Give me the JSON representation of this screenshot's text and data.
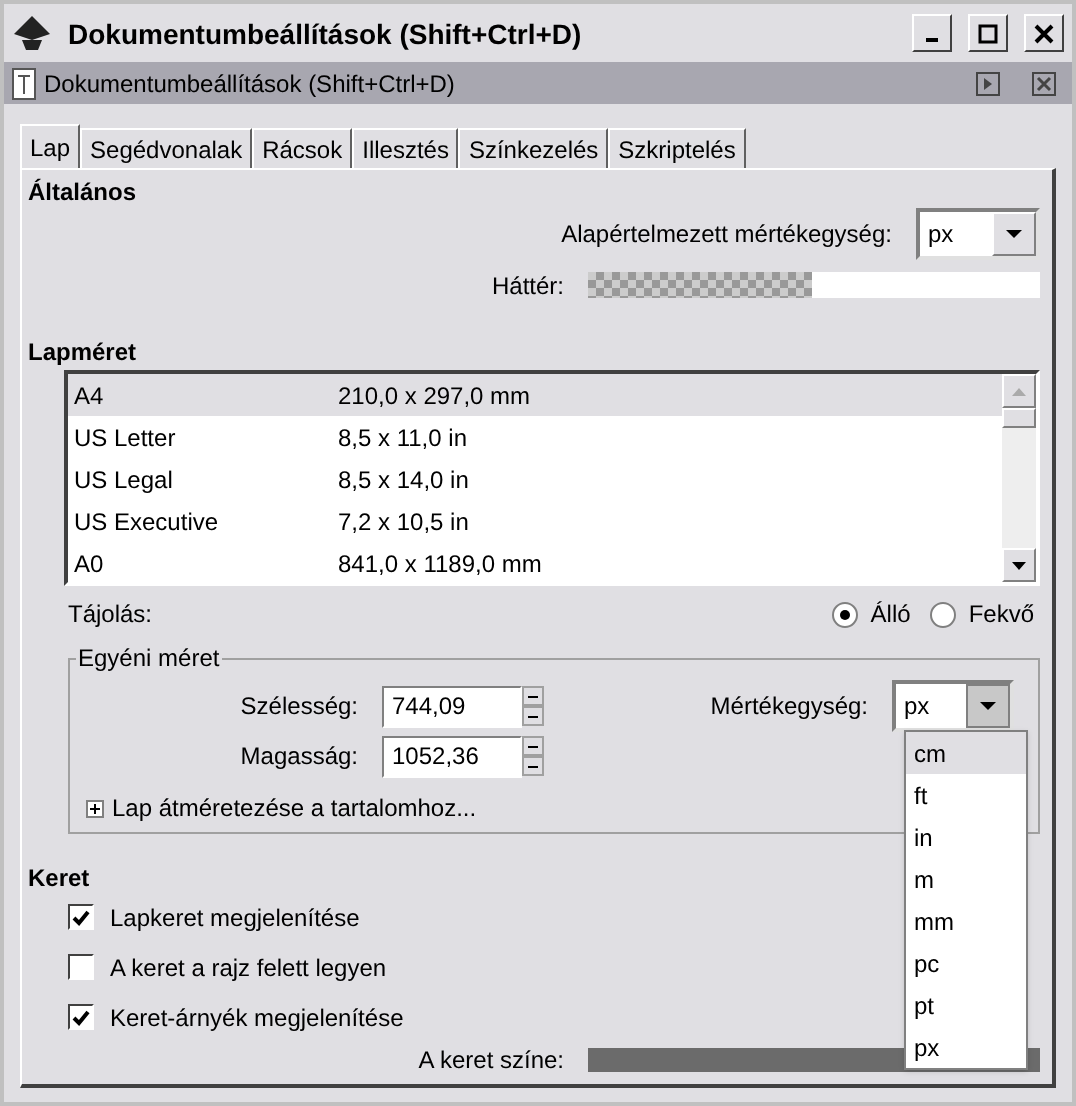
{
  "window": {
    "title": "Dokumentumbeállítások (Shift+Ctrl+D)"
  },
  "dock": {
    "title": "Dokumentumbeállítások (Shift+Ctrl+D)"
  },
  "tabs": [
    {
      "label": "Lap",
      "selected": true
    },
    {
      "label": "Segédvonalak",
      "selected": false
    },
    {
      "label": "Rácsok",
      "selected": false
    },
    {
      "label": "Illesztés",
      "selected": false
    },
    {
      "label": "Színkezelés",
      "selected": false
    },
    {
      "label": "Szkriptelés",
      "selected": false
    }
  ],
  "general": {
    "heading": "Általános",
    "unit_label": "Alapértelmezett mértékegység:",
    "unit_value": "px",
    "background_label": "Háttér:"
  },
  "page_size": {
    "heading": "Lapméret",
    "rows": [
      {
        "name": "A4",
        "size": "210,0 x 297,0 mm",
        "selected": true
      },
      {
        "name": "US Letter",
        "size": "8,5 x 11,0 in",
        "selected": false
      },
      {
        "name": "US Legal",
        "size": "8,5 x 14,0 in",
        "selected": false
      },
      {
        "name": "US Executive",
        "size": "7,2 x 10,5 in",
        "selected": false
      },
      {
        "name": "A0",
        "size": "841,0 x 1189,0 mm",
        "selected": false
      }
    ]
  },
  "orientation": {
    "label": "Tájolás:",
    "options": [
      {
        "label": "Álló",
        "selected": true
      },
      {
        "label": "Fekvő",
        "selected": false
      }
    ]
  },
  "custom_size": {
    "legend": "Egyéni méret",
    "width_label": "Szélesség:",
    "width_value": "744,09",
    "height_label": "Magasság:",
    "height_value": "1052,36",
    "unit_label": "Mértékegység:",
    "unit_value": "px",
    "expander": {
      "label": "Lap átméretezése a tartalomhoz...",
      "expanded": false
    },
    "unit_options": [
      {
        "label": "cm",
        "selected": true
      },
      {
        "label": "ft",
        "selected": false
      },
      {
        "label": "in",
        "selected": false
      },
      {
        "label": "m",
        "selected": false
      },
      {
        "label": "mm",
        "selected": false
      },
      {
        "label": "pc",
        "selected": false
      },
      {
        "label": "pt",
        "selected": false
      },
      {
        "label": "px",
        "selected": false
      }
    ]
  },
  "border": {
    "heading": "Keret",
    "options": [
      {
        "label": "Lapkeret megjelenítése",
        "checked": true
      },
      {
        "label": "A keret a rajz felett legyen",
        "checked": false
      },
      {
        "label": "Keret-árnyék megjelenítése",
        "checked": true
      }
    ],
    "color_label": "A keret színe:",
    "color": "#6b6b6b"
  }
}
